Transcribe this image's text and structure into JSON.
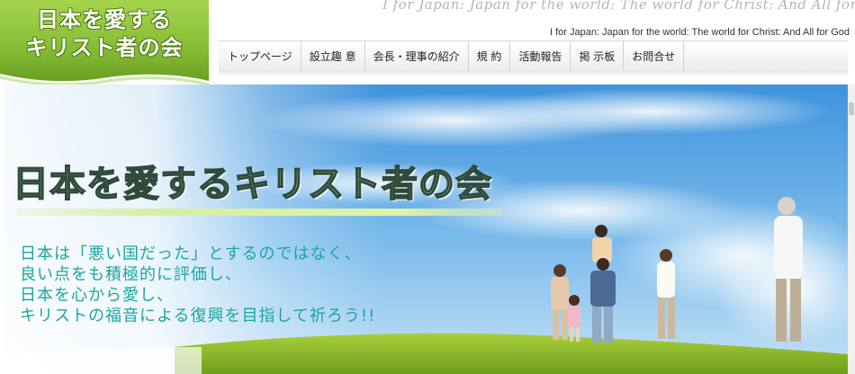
{
  "logo": {
    "line1": "日本を愛する",
    "line2": "キリスト者の会"
  },
  "header": {
    "watermark": "I for Japan:   Japan for the world:   The world for Christ:   And All for God",
    "tagline": "I for Japan:   Japan for the world:   The world for Christ:   And All for God"
  },
  "nav": {
    "items": [
      {
        "label": "トップページ"
      },
      {
        "label": "設立趣 意"
      },
      {
        "label": "会長・理事の紹介"
      },
      {
        "label": "規 約"
      },
      {
        "label": "活動報告"
      },
      {
        "label": "掲 示板"
      },
      {
        "label": "お問合せ"
      }
    ]
  },
  "hero": {
    "title": "日本を愛するキリスト者の会",
    "lines": [
      "日本は「悪い国だった」とするのではなく、",
      "良い点をも積極的に評価し、",
      "日本を心から愛し、",
      "キリストの福音による復興を目指して祈ろう!!"
    ]
  },
  "colors": {
    "logo_green": "#8cc43a",
    "hero_text": "#1aa6a0",
    "sky": "#5da9e6"
  }
}
